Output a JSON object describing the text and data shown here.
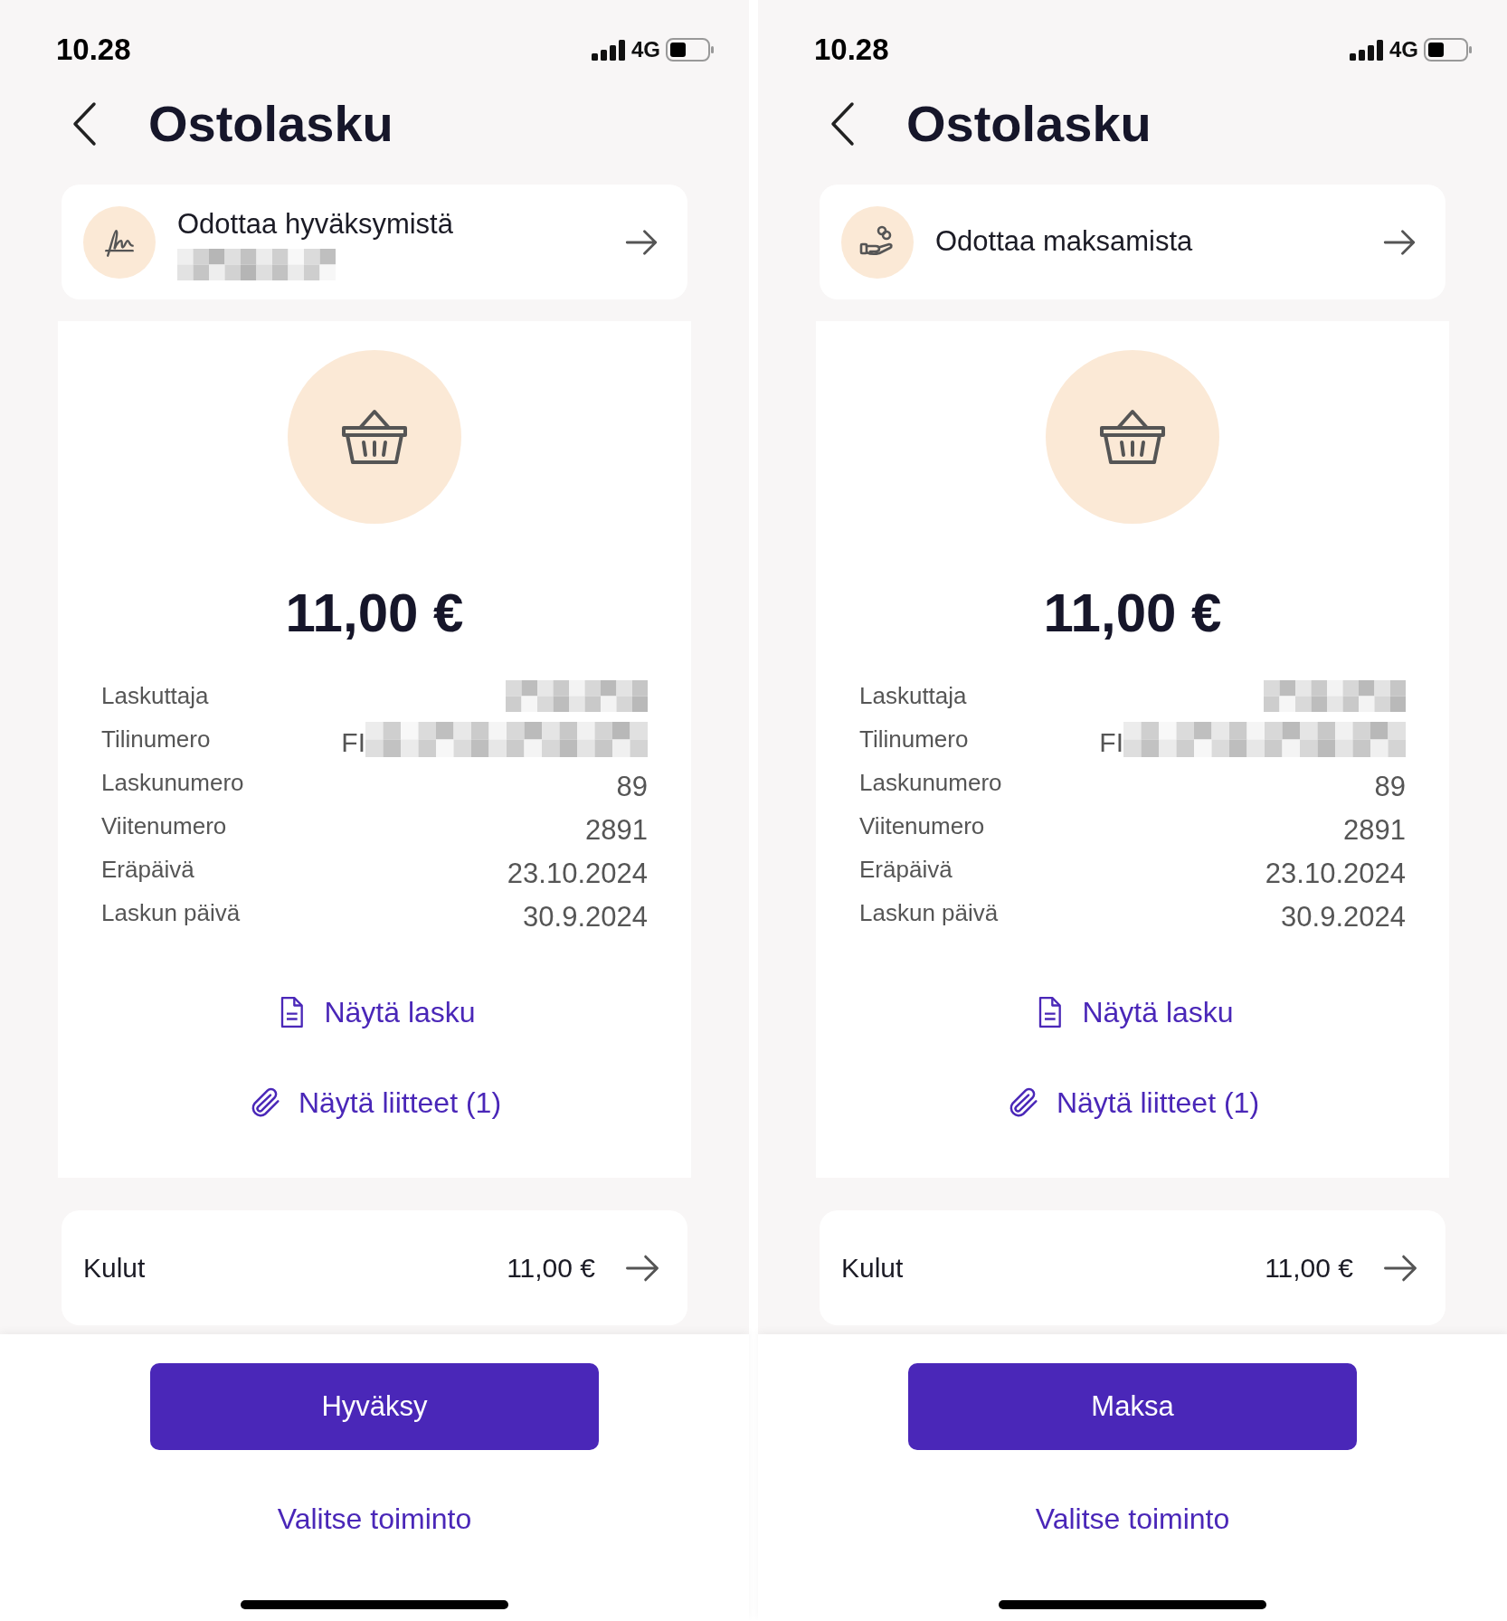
{
  "screens": [
    {
      "status_bar": {
        "time": "10.28",
        "network": "4G"
      },
      "title": "Ostolasku",
      "status": {
        "kind": "signature",
        "label": "Odottaa hyväksymistä",
        "subtitle_redacted": true
      },
      "amount": "11,00 €",
      "details": [
        {
          "label": "Laskuttaja",
          "kind": "redacted"
        },
        {
          "label": "Tilinumero",
          "kind": "partly_redacted",
          "value": "FI"
        },
        {
          "label": "Laskunumero",
          "kind": "text",
          "value": "89"
        },
        {
          "label": "Viitenumero",
          "kind": "text",
          "value": "2891"
        },
        {
          "label": "Eräpäivä",
          "kind": "text",
          "value": "23.10.2024"
        },
        {
          "label": "Laskun päivä",
          "kind": "text",
          "value": "30.9.2024"
        }
      ],
      "links": [
        {
          "kind": "document",
          "label": "Näytä lasku"
        },
        {
          "kind": "attachment",
          "label": "Näytä liitteet (1)"
        }
      ],
      "costs": {
        "label": "Kulut",
        "value": "11,00 €"
      },
      "primary_button": "Hyväksy",
      "secondary_link": "Valitse toiminto"
    },
    {
      "status_bar": {
        "time": "10.28",
        "network": "4G"
      },
      "title": "Ostolasku",
      "status": {
        "kind": "hand_coins",
        "label": "Odottaa maksamista",
        "subtitle_redacted": false
      },
      "amount": "11,00 €",
      "details": [
        {
          "label": "Laskuttaja",
          "kind": "redacted"
        },
        {
          "label": "Tilinumero",
          "kind": "partly_redacted",
          "value": "FI"
        },
        {
          "label": "Laskunumero",
          "kind": "text",
          "value": "89"
        },
        {
          "label": "Viitenumero",
          "kind": "text",
          "value": "2891"
        },
        {
          "label": "Eräpäivä",
          "kind": "text",
          "value": "23.10.2024"
        },
        {
          "label": "Laskun päivä",
          "kind": "text",
          "value": "30.9.2024"
        }
      ],
      "links": [
        {
          "kind": "document",
          "label": "Näytä lasku"
        },
        {
          "kind": "attachment",
          "label": "Näytä liitteet (1)"
        }
      ],
      "costs": {
        "label": "Kulut",
        "value": "11,00 €"
      },
      "primary_button": "Maksa",
      "secondary_link": "Valitse toiminto"
    }
  ]
}
